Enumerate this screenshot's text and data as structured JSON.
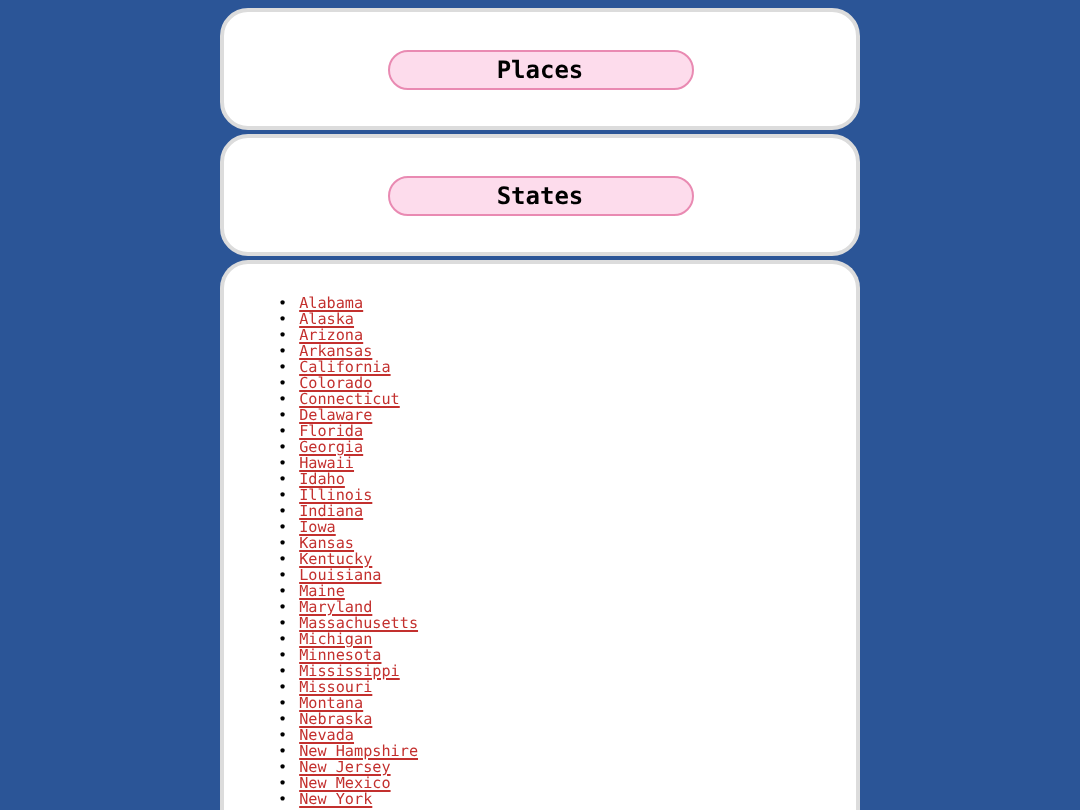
{
  "nav_buttons": [
    {
      "label": "Places"
    },
    {
      "label": "States"
    }
  ],
  "states": [
    {
      "marker": "•",
      "name": "Alabama"
    },
    {
      "marker": "•",
      "name": "Alaska"
    },
    {
      "marker": "•",
      "name": "Arizona"
    },
    {
      "marker": "•",
      "name": "Arkansas"
    },
    {
      "marker": "•",
      "name": "California"
    },
    {
      "marker": "•",
      "name": "Colorado"
    },
    {
      "marker": "•",
      "name": "Connecticut"
    },
    {
      "marker": "•",
      "name": "Delaware"
    },
    {
      "marker": "•",
      "name": "Florida"
    },
    {
      "marker": "•",
      "name": "Georgia"
    },
    {
      "marker": "•",
      "name": "Hawaii"
    },
    {
      "marker": "•",
      "name": "Idaho"
    },
    {
      "marker": "•",
      "name": "Illinois"
    },
    {
      "marker": "•",
      "name": "Indiana"
    },
    {
      "marker": "•",
      "name": "Iowa"
    },
    {
      "marker": "•",
      "name": "Kansas"
    },
    {
      "marker": "•",
      "name": "Kentucky"
    },
    {
      "marker": "•",
      "name": "Louisiana"
    },
    {
      "marker": "•",
      "name": "Maine"
    },
    {
      "marker": "•",
      "name": "Maryland"
    },
    {
      "marker": "•",
      "name": "Massachusetts"
    },
    {
      "marker": "•",
      "name": "Michigan"
    },
    {
      "marker": "•",
      "name": "Minnesota"
    },
    {
      "marker": "•",
      "name": "Mississippi"
    },
    {
      "marker": "•",
      "name": "Missouri"
    },
    {
      "marker": "•",
      "name": "Montana"
    },
    {
      "marker": "•",
      "name": "Nebraska"
    },
    {
      "marker": "•",
      "name": "Nevada"
    },
    {
      "marker": "•",
      "name": "New Hampshire"
    },
    {
      "marker": "•",
      "name": "New Jersey"
    },
    {
      "marker": "•",
      "name": "New Mexico"
    },
    {
      "marker": "•",
      "name": "New York"
    }
  ]
}
